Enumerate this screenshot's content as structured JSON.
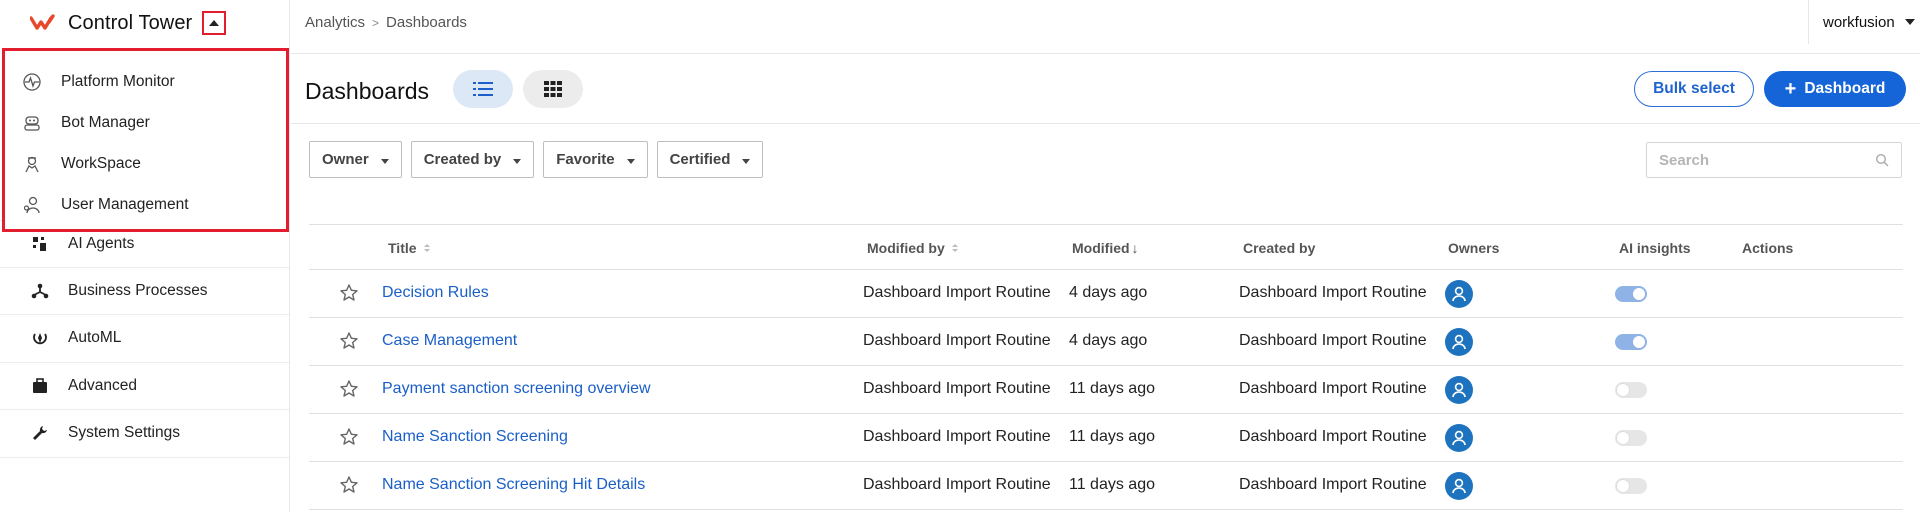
{
  "app": {
    "title": "Control Tower",
    "brand_color": "#e8482a"
  },
  "dropdown": {
    "items": [
      {
        "label": "Platform Monitor",
        "icon": "pulse-monitor-icon"
      },
      {
        "label": "Bot Manager",
        "icon": "bot-icon"
      },
      {
        "label": "WorkSpace",
        "icon": "worker-icon"
      },
      {
        "label": "User Management",
        "icon": "user-gear-icon"
      }
    ]
  },
  "sidebar": {
    "items": [
      {
        "label": "AI Agents",
        "icon": "ai-agents-icon"
      },
      {
        "label": "Business Processes",
        "icon": "process-network-icon"
      },
      {
        "label": "AutoML",
        "icon": "automl-icon"
      },
      {
        "label": "Advanced",
        "icon": "briefcase-icon"
      },
      {
        "label": "System Settings",
        "icon": "wrench-icon"
      }
    ]
  },
  "header": {
    "breadcrumb": [
      "Analytics",
      "Dashboards"
    ],
    "user": "workfusion"
  },
  "page": {
    "title": "Dashboards",
    "bulk_select_label": "Bulk select",
    "add_dashboard_label": "Dashboard"
  },
  "filters": [
    "Owner",
    "Created by",
    "Favorite",
    "Certified"
  ],
  "search": {
    "placeholder": "Search",
    "value": ""
  },
  "table": {
    "columns": {
      "title": "Title",
      "modified_by": "Modified by",
      "modified": "Modified",
      "created_by": "Created by",
      "owners": "Owners",
      "ai_insights": "AI insights",
      "actions": "Actions"
    },
    "rows": [
      {
        "title": "Decision Rules",
        "modified_by": "Dashboard Import Routine",
        "modified": "4 days ago",
        "created_by": "Dashboard Import Routine",
        "ai_insights": true
      },
      {
        "title": "Case Management",
        "modified_by": "Dashboard Import Routine",
        "modified": "4 days ago",
        "created_by": "Dashboard Import Routine",
        "ai_insights": true
      },
      {
        "title": "Payment sanction screening overview",
        "modified_by": "Dashboard Import Routine",
        "modified": "11 days ago",
        "created_by": "Dashboard Import Routine",
        "ai_insights": false
      },
      {
        "title": "Name Sanction Screening",
        "modified_by": "Dashboard Import Routine",
        "modified": "11 days ago",
        "created_by": "Dashboard Import Routine",
        "ai_insights": false
      },
      {
        "title": "Name Sanction Screening Hit Details",
        "modified_by": "Dashboard Import Routine",
        "modified": "11 days ago",
        "created_by": "Dashboard Import Routine",
        "ai_insights": false
      }
    ]
  },
  "colors": {
    "accent_blue": "#1565d8",
    "link_blue": "#1a5fc9",
    "highlight_red": "#e11d2e",
    "avatar_blue": "#1e73be"
  }
}
